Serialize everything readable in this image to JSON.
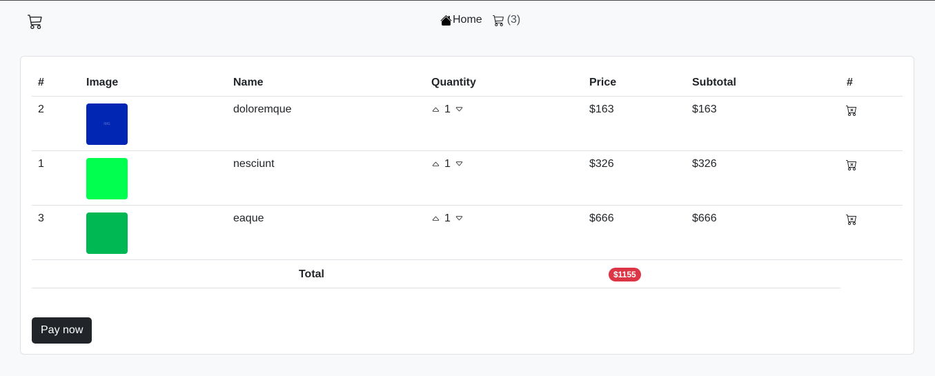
{
  "nav": {
    "brand_icon": "cart-icon",
    "home_label": "Home",
    "cart_count": "(3)"
  },
  "table": {
    "headers": [
      "#",
      "Image",
      "Name",
      "Quantity",
      "Price",
      "Subtotal",
      "#"
    ],
    "rows": [
      {
        "id": "2",
        "name": "doloremque",
        "quantity": "1",
        "price": "$163",
        "subtotal": "$163",
        "image_color": "#0026b3"
      },
      {
        "id": "1",
        "name": "nesciunt",
        "quantity": "1",
        "price": "$326",
        "subtotal": "$326",
        "image_color": "#00ff4e"
      },
      {
        "id": "3",
        "name": "eaque",
        "quantity": "1",
        "price": "$666",
        "subtotal": "$666",
        "image_color": "#00b853"
      }
    ],
    "total_label": "Total",
    "total_value": "$1155"
  },
  "pay_label": "Pay now",
  "colors": {
    "badge": "#dc3545",
    "button": "#212529",
    "background": "#f8f9fa"
  }
}
